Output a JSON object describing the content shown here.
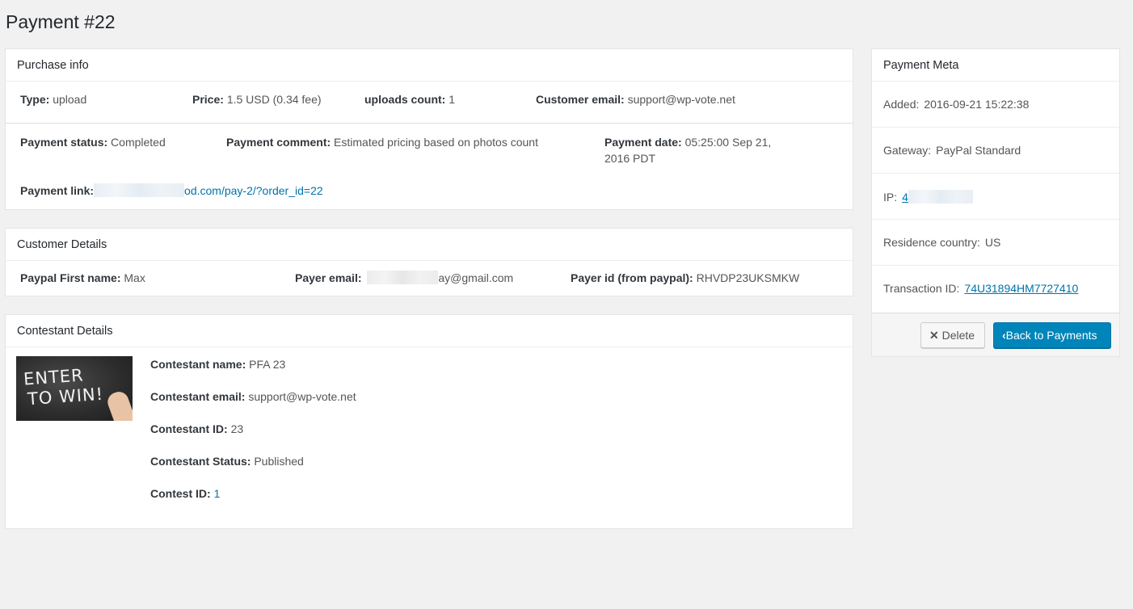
{
  "page": {
    "title": "Payment #22"
  },
  "purchase": {
    "heading": "Purchase info",
    "type_label": "Type:",
    "type_value": "upload",
    "price_label": "Price:",
    "price_value": "1.5 USD (0.34 fee)",
    "uploads_label": "uploads count:",
    "uploads_value": "1",
    "email_label": "Customer email:",
    "email_value": "support@wp-vote.net",
    "status_label": "Payment status:",
    "status_value": "Completed",
    "comment_label": "Payment comment:",
    "comment_value": "Estimated pricing based on photos count",
    "date_label": "Payment date:",
    "date_value_1": "05:25:00 Sep 21,",
    "date_value_2": "2016 PDT",
    "link_label": "Payment link:",
    "link_value": "od.com/pay-2/?order_id=22"
  },
  "customer": {
    "heading": "Customer Details",
    "first_name_label": "Paypal First name:",
    "first_name_value": "Max",
    "payer_email_label": "Payer email:",
    "payer_email_value": "ay@gmail.com",
    "payer_id_label": "Payer id (from paypal):",
    "payer_id_value": "RHVDP23UKSMKW"
  },
  "contestant": {
    "heading": "Contestant Details",
    "image_text_1": "ENTER",
    "image_text_2": "TO WIN!",
    "name_label": "Contestant name:",
    "name_value": "PFA 23",
    "email_label": "Contestant email:",
    "email_value": "support@wp-vote.net",
    "id_label": "Contestant ID:",
    "id_value": "23",
    "status_label": "Contestant Status:",
    "status_value": "Published",
    "contest_id_label": "Contest ID:",
    "contest_id_value": "1"
  },
  "meta": {
    "heading": "Payment Meta",
    "added_label": "Added:",
    "added_value": "2016-09-21 15:22:38",
    "gateway_label": "Gateway:",
    "gateway_value": "PayPal Standard",
    "ip_label": "IP:",
    "ip_value": "4",
    "country_label": "Residence country:",
    "country_value": "US",
    "transaction_label": "Transaction ID:",
    "transaction_value": "74U31894HM7727410",
    "delete_label": "Delete",
    "back_label": "Back to Payments"
  },
  "colors": {
    "link": "#0073aa",
    "primary_button": "#0085ba",
    "background": "#f1f1f1"
  },
  "icons": {
    "delete": "x-icon",
    "back": "chevron-left-icon"
  }
}
